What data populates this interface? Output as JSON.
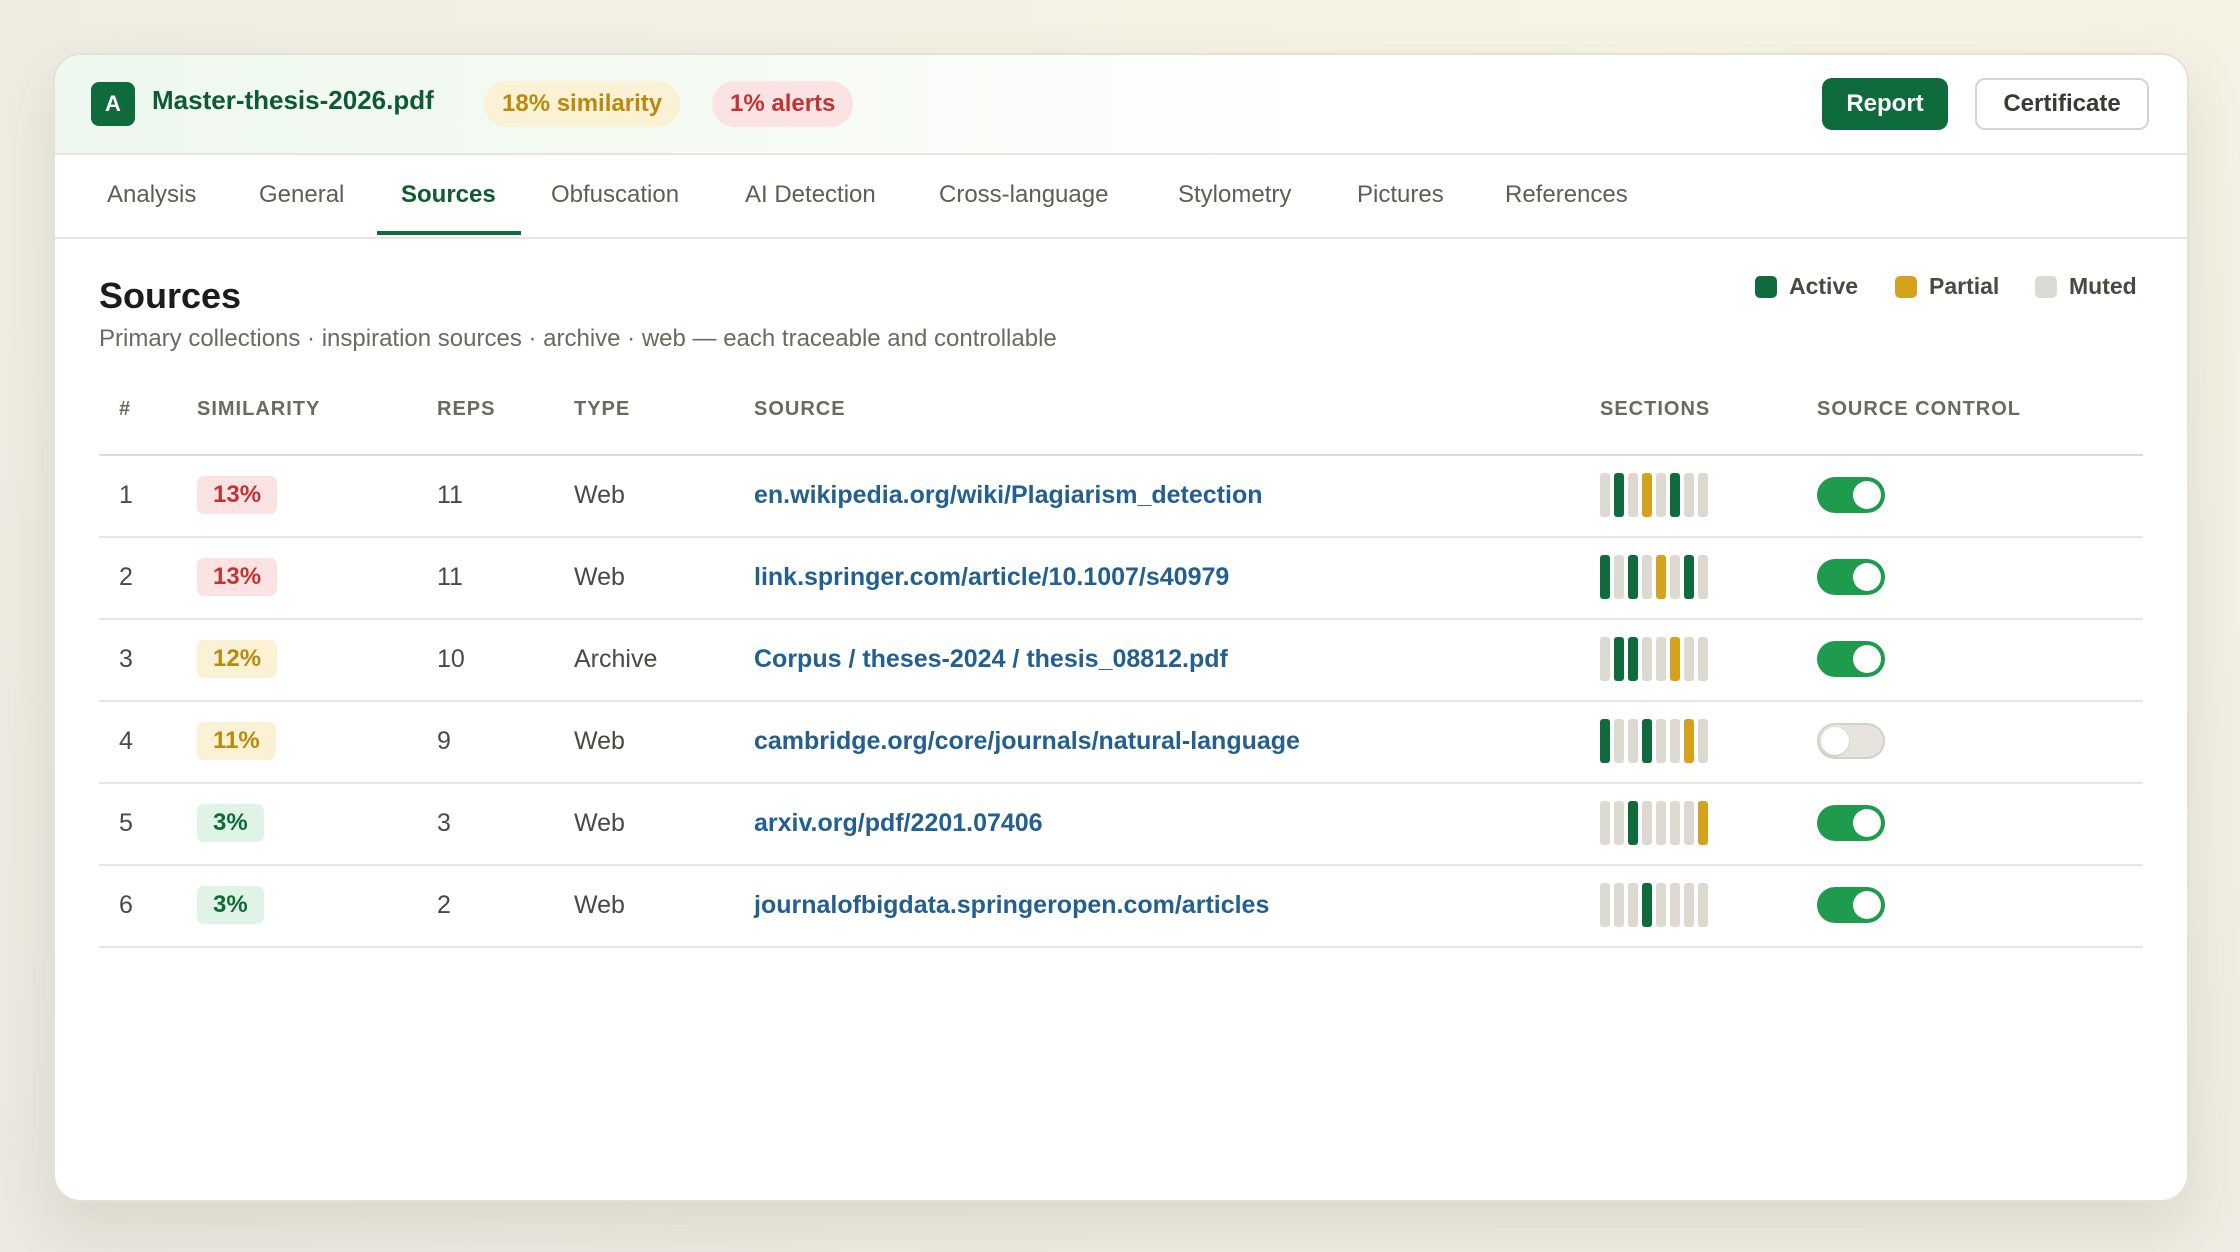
{
  "header": {
    "logo_letter": "A",
    "filename": "Master-thesis-2026.pdf",
    "similarity_pill": "18% similarity",
    "alerts_pill": "1% alerts",
    "report_label": "Report",
    "certificate_label": "Certificate"
  },
  "tabs": [
    {
      "label": "Analysis"
    },
    {
      "label": "General"
    },
    {
      "label": "Sources",
      "active": true
    },
    {
      "label": "Obfuscation"
    },
    {
      "label": "AI Detection"
    },
    {
      "label": "Cross-language"
    },
    {
      "label": "Stylometry"
    },
    {
      "label": "Pictures"
    },
    {
      "label": "References"
    }
  ],
  "main": {
    "title": "Sources",
    "subtitle": "Primary collections · inspiration sources · archive · web — each traceable and controllable"
  },
  "legend": [
    {
      "label": "Active",
      "color": "#0f6b3b"
    },
    {
      "label": "Partial",
      "color": "#d4a21c"
    },
    {
      "label": "Muted",
      "color": "#dcdad0"
    }
  ],
  "table": {
    "columns": [
      "#",
      "SIMILARITY",
      "REPS",
      "TYPE",
      "SOURCE",
      "SECTIONS",
      "SOURCE CONTROL"
    ],
    "rows": [
      {
        "num": "1",
        "similarity": "13%",
        "level": "red",
        "reps": "11",
        "type": "Web",
        "source": "en.wikipedia.org/wiki/Plagiarism_detection",
        "sections": [
          "m",
          "a",
          "m",
          "p",
          "m",
          "a",
          "m",
          "m"
        ],
        "enabled": true
      },
      {
        "num": "2",
        "similarity": "13%",
        "level": "red",
        "reps": "11",
        "type": "Web",
        "source": "link.springer.com/article/10.1007/s40979",
        "sections": [
          "a",
          "m",
          "a",
          "m",
          "p",
          "m",
          "a",
          "m"
        ],
        "enabled": true
      },
      {
        "num": "3",
        "similarity": "12%",
        "level": "amber",
        "reps": "10",
        "type": "Archive",
        "source": "Corpus / theses-2024 / thesis_08812.pdf",
        "sections": [
          "m",
          "a",
          "a",
          "m",
          "m",
          "p",
          "m",
          "m"
        ],
        "enabled": true
      },
      {
        "num": "4",
        "similarity": "11%",
        "level": "amber",
        "reps": "9",
        "type": "Web",
        "source": "cambridge.org/core/journals/natural-language",
        "sections": [
          "a",
          "m",
          "m",
          "a",
          "m",
          "m",
          "p",
          "m"
        ],
        "enabled": false
      },
      {
        "num": "5",
        "similarity": "3%",
        "level": "green",
        "reps": "3",
        "type": "Web",
        "source": "arxiv.org/pdf/2201.07406",
        "sections": [
          "m",
          "m",
          "a",
          "m",
          "m",
          "m",
          "m",
          "p"
        ],
        "enabled": true
      },
      {
        "num": "6",
        "similarity": "3%",
        "level": "green",
        "reps": "2",
        "type": "Web",
        "source": "journalofbigdata.springeropen.com/articles",
        "sections": [
          "m",
          "m",
          "m",
          "a",
          "m",
          "m",
          "m",
          "m"
        ],
        "enabled": true
      }
    ]
  }
}
